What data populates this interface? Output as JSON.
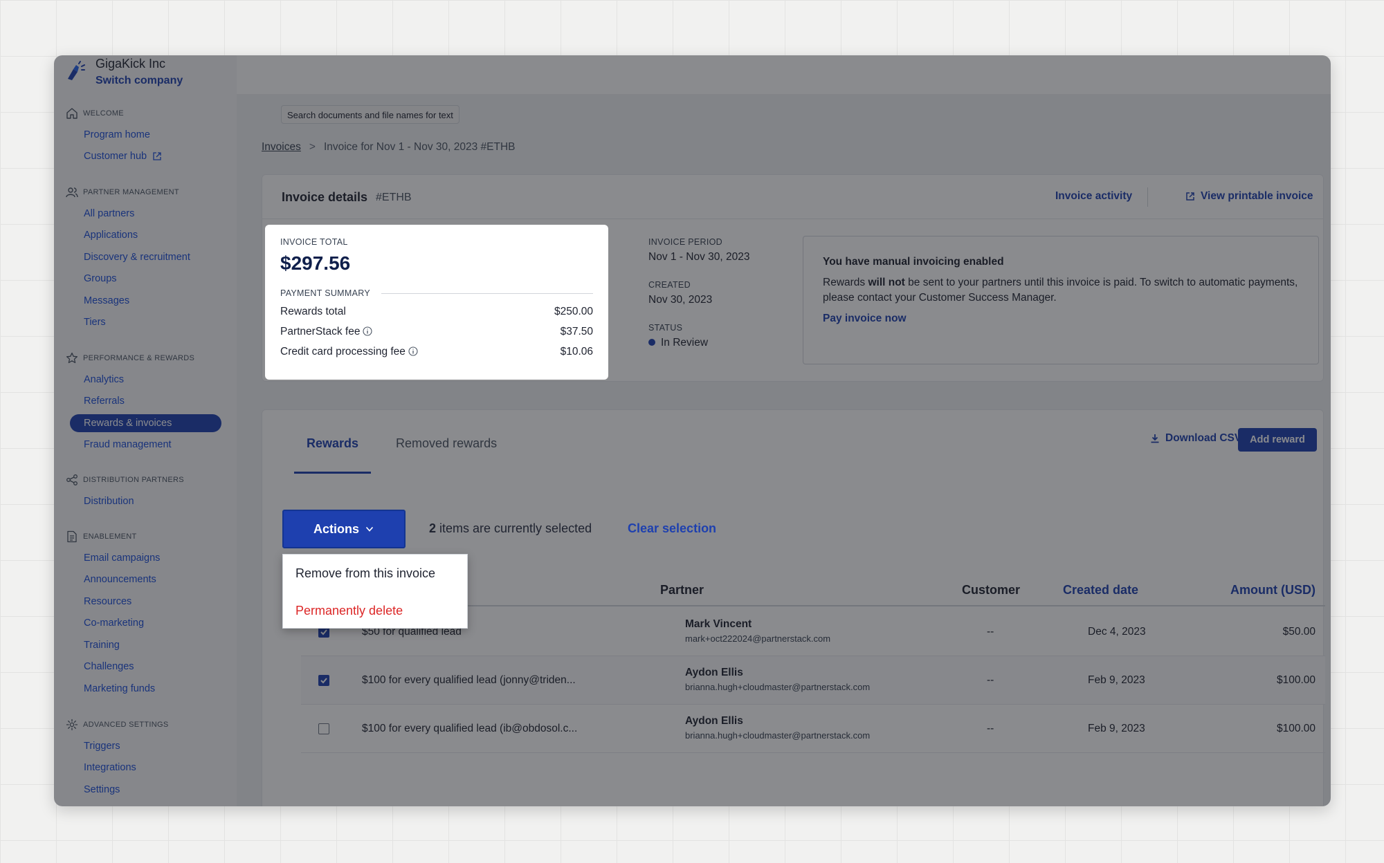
{
  "company": {
    "name": "GigaKick Inc",
    "switch_label": "Switch company"
  },
  "sidebar": {
    "welcome": {
      "header": "Welcome",
      "items": [
        {
          "label": "Program home"
        },
        {
          "label": "Customer hub"
        }
      ]
    },
    "partner_management": {
      "header": "Partner management",
      "items": [
        {
          "label": "All partners"
        },
        {
          "label": "Applications"
        },
        {
          "label": "Discovery & recruitment"
        },
        {
          "label": "Groups"
        },
        {
          "label": "Messages"
        },
        {
          "label": "Tiers"
        }
      ]
    },
    "performance": {
      "header": "Performance & rewards",
      "items": [
        {
          "label": "Analytics"
        },
        {
          "label": "Referrals"
        },
        {
          "label": "Rewards & invoices",
          "active": true
        },
        {
          "label": "Fraud management"
        }
      ]
    },
    "distribution": {
      "header": "Distribution partners",
      "items": [
        {
          "label": "Distribution"
        }
      ]
    },
    "enablement": {
      "header": "Enablement",
      "items": [
        {
          "label": "Email campaigns"
        },
        {
          "label": "Announcements"
        },
        {
          "label": "Resources"
        },
        {
          "label": "Co-marketing"
        },
        {
          "label": "Training"
        },
        {
          "label": "Challenges"
        },
        {
          "label": "Marketing funds"
        }
      ]
    },
    "advanced": {
      "header": "Advanced settings",
      "items": [
        {
          "label": "Triggers"
        },
        {
          "label": "Integrations"
        },
        {
          "label": "Settings"
        }
      ]
    }
  },
  "search_tooltip": "Search documents and file names for text",
  "breadcrumb": {
    "root": "Invoices",
    "separator": ">",
    "current": "Invoice for Nov 1 - Nov 30, 2023 #ETHB"
  },
  "invoice": {
    "title": "Invoice details",
    "id": "#ETHB",
    "activity_link": "Invoice activity",
    "printable_link": "View printable invoice",
    "total_label": "Invoice total",
    "total": "$297.56",
    "payment_summary_label": "Payment summary",
    "lines": [
      {
        "label": "Rewards total",
        "value": "$250.00"
      },
      {
        "label": "PartnerStack fee",
        "value": "$37.50"
      },
      {
        "label": "Credit card processing fee",
        "value": "$10.06"
      }
    ],
    "period_label": "Invoice period",
    "period": "Nov 1 - Nov 30, 2023",
    "created_label": "Created",
    "created": "Nov 30, 2023",
    "status_label": "Status",
    "status": "In Review",
    "status_color": "#1e40af"
  },
  "notice": {
    "title": "You have manual invoicing enabled",
    "body_prefix": "Rewards ",
    "body_bold": "will not",
    "body_suffix": " be sent to your partners until this invoice is paid. To switch to automatic payments, please contact your Customer Success Manager.",
    "link": "Pay invoice now"
  },
  "rewards": {
    "tabs": [
      {
        "label": "Rewards",
        "active": true
      },
      {
        "label": "Removed rewards"
      }
    ],
    "download_csv": "Download CSV",
    "add_reward": "Add reward",
    "actions_label": "Actions",
    "selected_count": "2",
    "selected_text": " items are currently selected",
    "clear_selection": "Clear selection",
    "actions_menu": [
      {
        "label": "Remove from this invoice"
      },
      {
        "label": "Permanently delete"
      }
    ],
    "columns": {
      "partner": "Partner",
      "customer": "Customer",
      "created": "Created date",
      "amount": "Amount (USD)"
    },
    "rows": [
      {
        "checked": true,
        "description": "$50 for qualified lead",
        "partner": "Mark Vincent",
        "email": "mark+oct222024@partnerstack.com",
        "customer": "--",
        "date": "Dec 4, 2023",
        "amount": "$50.00"
      },
      {
        "checked": true,
        "description": "$100 for every qualified lead (jonny@triden...",
        "partner": "Aydon Ellis",
        "email": "brianna.hugh+cloudmaster@partnerstack.com",
        "customer": "--",
        "date": "Feb 9, 2023",
        "amount": "$100.00"
      },
      {
        "checked": false,
        "description": "$100 for every qualified lead (ib@obdosol.c...",
        "partner": "Aydon Ellis",
        "email": "brianna.hugh+cloudmaster@partnerstack.com",
        "customer": "--",
        "date": "Feb 9, 2023",
        "amount": "$100.00"
      }
    ]
  },
  "colors": {
    "accent": "#1e40af",
    "danger": "#dc2626",
    "overlay": "rgba(22,24,30,0.50)"
  }
}
